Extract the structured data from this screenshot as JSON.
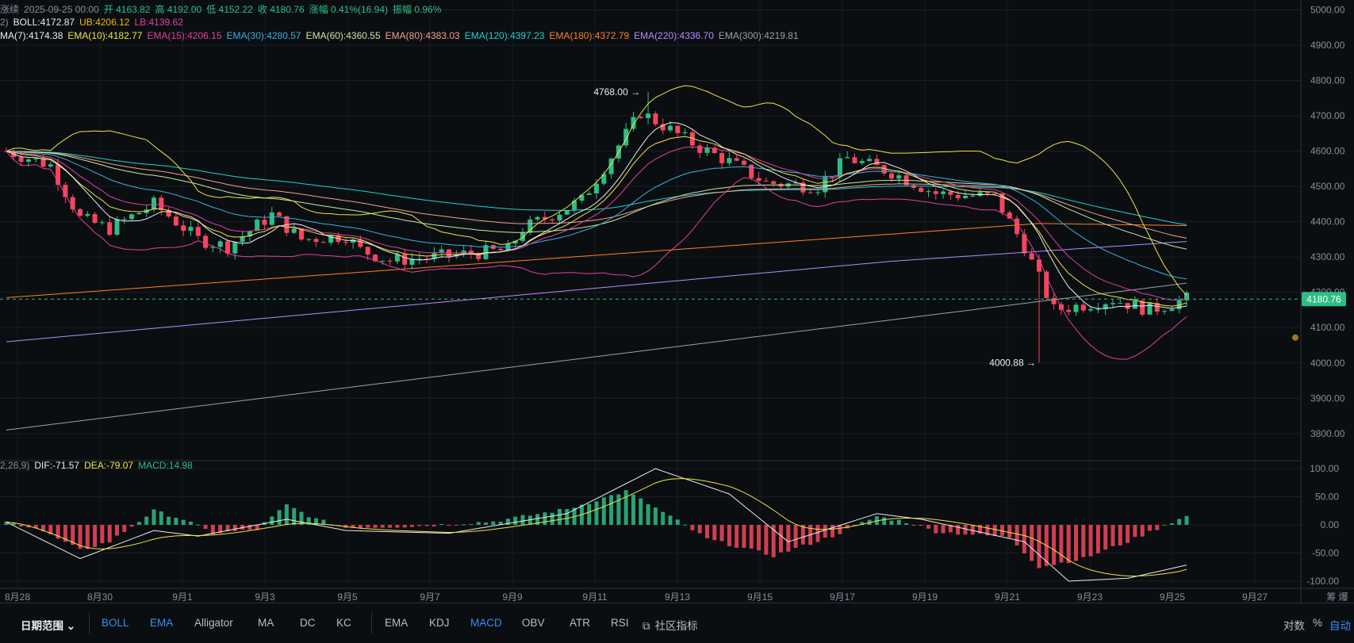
{
  "header": {
    "line1": [
      {
        "text": "涨续",
        "color": "#848e9c"
      },
      {
        "text": "2025-09-25 00:00",
        "color": "#848e9c"
      },
      {
        "text": "开 4163.82",
        "color": "#2ebd85"
      },
      {
        "text": "高 4192.00",
        "color": "#2ebd85"
      },
      {
        "text": "低 4152.22",
        "color": "#2ebd85"
      },
      {
        "text": "收 4180.76",
        "color": "#2ebd85"
      },
      {
        "text": "涨幅 0.41%(16.94)",
        "color": "#2ebd85"
      },
      {
        "text": "振幅 0.96%",
        "color": "#2ebd85"
      }
    ],
    "line2": [
      {
        "text": "2)",
        "color": "#848e9c"
      },
      {
        "text": "BOLL:4172.87",
        "color": "#eaecef"
      },
      {
        "text": "UB:4206.12",
        "color": "#f0b90b"
      },
      {
        "text": "LB:4139.62",
        "color": "#e040a0"
      }
    ],
    "line3": [
      {
        "text": "MA(7):4174.38",
        "color": "#eaecef"
      },
      {
        "text": "EMA(10):4182.77",
        "color": "#f0e24a"
      },
      {
        "text": "EMA(15):4206.15",
        "color": "#e040a0"
      },
      {
        "text": "EMA(30):4280.57",
        "color": "#3ab0e0"
      },
      {
        "text": "EMA(60):4360.55",
        "color": "#c8e6a0"
      },
      {
        "text": "EMA(80):4383.03",
        "color": "#f0a090"
      },
      {
        "text": "EMA(120):4397.23",
        "color": "#20d0d0"
      },
      {
        "text": "EMA(180):4372.79",
        "color": "#ff7f27"
      },
      {
        "text": "EMA(220):4336.70",
        "color": "#b48cff"
      },
      {
        "text": "EMA(300):4219.81",
        "color": "#9aa0a8"
      }
    ],
    "macd_line": [
      {
        "text": "2,26,9)",
        "color": "#848e9c"
      },
      {
        "text": "DIF:-71.57",
        "color": "#eaecef"
      },
      {
        "text": "DEA:-79.07",
        "color": "#f0e24a"
      },
      {
        "text": "MACD:14.98",
        "color": "#2ebd85"
      }
    ]
  },
  "chart_data": {
    "type": "candlestick",
    "price_axis": {
      "ticks": [
        3800,
        3900,
        4000,
        4100,
        4200,
        4300,
        4400,
        4500,
        4600,
        4700,
        4800,
        4900,
        5000
      ],
      "range": [
        3730,
        5010
      ]
    },
    "current_price": "4180.76",
    "annotations": {
      "high": "4768.00",
      "low": "4000.88"
    },
    "macd_axis": {
      "ticks": [
        "100.00",
        "50.00",
        "0.00",
        "-50.00",
        "-100.00"
      ],
      "range": [
        -110,
        110
      ]
    },
    "x_labels": [
      "8月28",
      "8月30",
      "9月1",
      "9月3",
      "9月5",
      "9月7",
      "9月9",
      "9月11",
      "9月13",
      "9月15",
      "9月17",
      "9月19",
      "9月21",
      "9月23",
      "9月25",
      "9月27"
    ],
    "candles": {
      "keypoints": [
        [
          0,
          4600
        ],
        [
          6,
          4560
        ],
        [
          10,
          4410
        ],
        [
          14,
          4380
        ],
        [
          20,
          4450
        ],
        [
          26,
          4350
        ],
        [
          30,
          4330
        ],
        [
          36,
          4420
        ],
        [
          40,
          4350
        ],
        [
          46,
          4360
        ],
        [
          48,
          4320
        ],
        [
          52,
          4290
        ],
        [
          58,
          4300
        ],
        [
          68,
          4320
        ],
        [
          70,
          4380
        ],
        [
          78,
          4460
        ],
        [
          86,
          4710
        ],
        [
          90,
          4660
        ],
        [
          94,
          4610
        ],
        [
          98,
          4570
        ],
        [
          103,
          4510
        ],
        [
          110,
          4500
        ],
        [
          114,
          4580
        ],
        [
          120,
          4540
        ],
        [
          126,
          4480
        ],
        [
          134,
          4470
        ],
        [
          138,
          4330
        ],
        [
          142,
          4150
        ],
        [
          150,
          4180
        ],
        [
          155,
          4150
        ],
        [
          160,
          4181
        ]
      ],
      "count": 161,
      "high_marker_index": 87,
      "low_marker_index": 140
    },
    "macd": {
      "keypoints": [
        [
          0,
          5
        ],
        [
          4,
          -5
        ],
        [
          10,
          -45
        ],
        [
          14,
          -30
        ],
        [
          20,
          25
        ],
        [
          24,
          10
        ],
        [
          28,
          -15
        ],
        [
          34,
          -8
        ],
        [
          38,
          35
        ],
        [
          42,
          10
        ],
        [
          46,
          -5
        ],
        [
          56,
          -2
        ],
        [
          66,
          6
        ],
        [
          76,
          28
        ],
        [
          84,
          60
        ],
        [
          90,
          15
        ],
        [
          95,
          -25
        ],
        [
          104,
          -55
        ],
        [
          112,
          -20
        ],
        [
          118,
          15
        ],
        [
          122,
          5
        ],
        [
          126,
          -12
        ],
        [
          136,
          -22
        ],
        [
          140,
          -75
        ],
        [
          146,
          -60
        ],
        [
          152,
          -30
        ],
        [
          158,
          5
        ],
        [
          160,
          15
        ]
      ],
      "dif_end": -71.57,
      "dea_end": -79.07
    },
    "indicator_colors": {
      "boll": "#f0e24a",
      "boll_lb": "#e040a0",
      "ma7": "#eaecef",
      "ema10": "#f0e24a",
      "ema15": "#e040a0",
      "ema30": "#3ab0e0",
      "ema60": "#c8e6a0",
      "ema80": "#f0a090",
      "ema120": "#20d0d0",
      "ema180": "#ff7f27",
      "ema220": "#b48cff",
      "ema300": "#9aa0a8"
    },
    "up_color": "#2ebd85",
    "down_color": "#f6465d"
  },
  "toolbar": {
    "range_label": "日期范围",
    "main_indicators": [
      "BOLL",
      "EMA",
      "Alligator",
      "MA",
      "DC",
      "KC"
    ],
    "main_active": [
      "BOLL",
      "EMA"
    ],
    "sub_indicators": [
      "EMA",
      "KDJ",
      "MACD",
      "OBV",
      "ATR",
      "RSI"
    ],
    "sub_active": [
      "MACD"
    ],
    "community": "社区指标",
    "right": [
      "对数",
      "%",
      "自动"
    ],
    "axis_corner": "筹 爆"
  }
}
